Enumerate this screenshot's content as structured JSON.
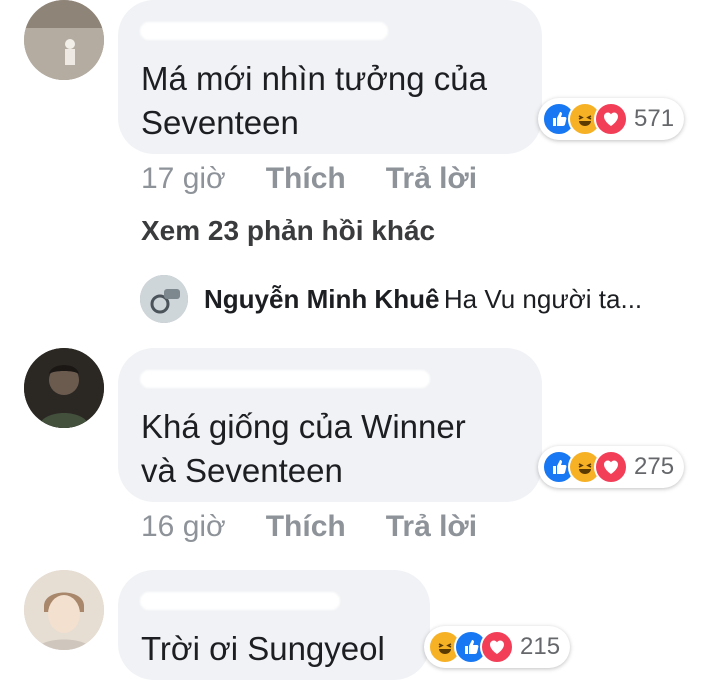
{
  "comments": [
    {
      "text_line1": "Má mới nhìn tưởng của",
      "text_line2": "Seventeen",
      "reaction_count": "571",
      "time": "17 giờ",
      "like_label": "Thích",
      "reply_label": "Trả lời"
    },
    {
      "text_line1": "Khá giống của Winner",
      "text_line2": "và Seventeen",
      "reaction_count": "275",
      "time": "16 giờ",
      "like_label": "Thích",
      "reply_label": "Trả lời"
    },
    {
      "text_line1": "Trời ơi Sungyeol",
      "reaction_count": "215"
    }
  ],
  "replies_link": "Xem 23 phản hồi khác",
  "reply_preview": {
    "name": "Nguyễn Minh Khuê",
    "text": "Ha Vu người ta..."
  },
  "colors": {
    "bubble": "#f0f2f5",
    "meta_text": "#8e939a",
    "like": "#1877f2",
    "love": "#f33e58",
    "haha": "#f7b125"
  }
}
